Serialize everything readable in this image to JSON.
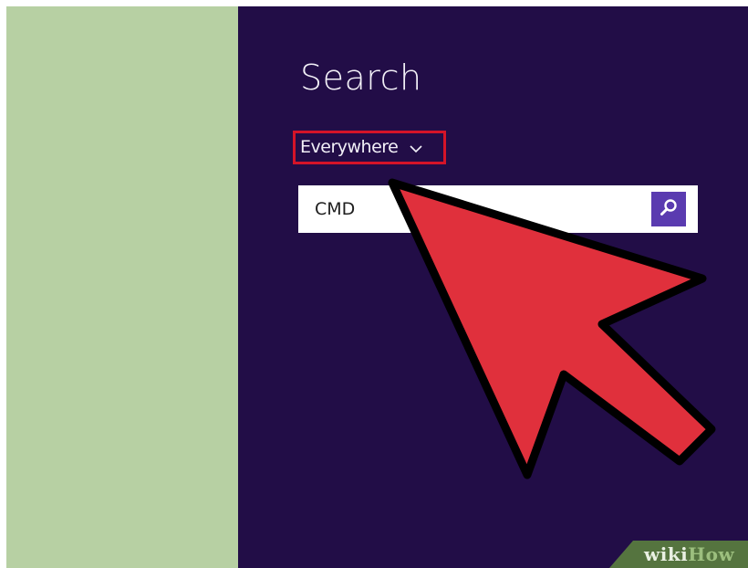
{
  "charms": {
    "title": "Search",
    "scope": {
      "selected": "Everywhere",
      "icon": "chevron-down-icon"
    },
    "search": {
      "value": "CMD",
      "button_icon": "magnifier-icon"
    }
  },
  "annotation": {
    "highlight_color": "#d41428",
    "arrow_color": "#e0303c"
  },
  "watermark": {
    "wiki": "wiki",
    "how": "How"
  },
  "colors": {
    "left_panel": "#b7d0a3",
    "charm_pane": "#220d47",
    "search_button": "#5a3bb0"
  }
}
